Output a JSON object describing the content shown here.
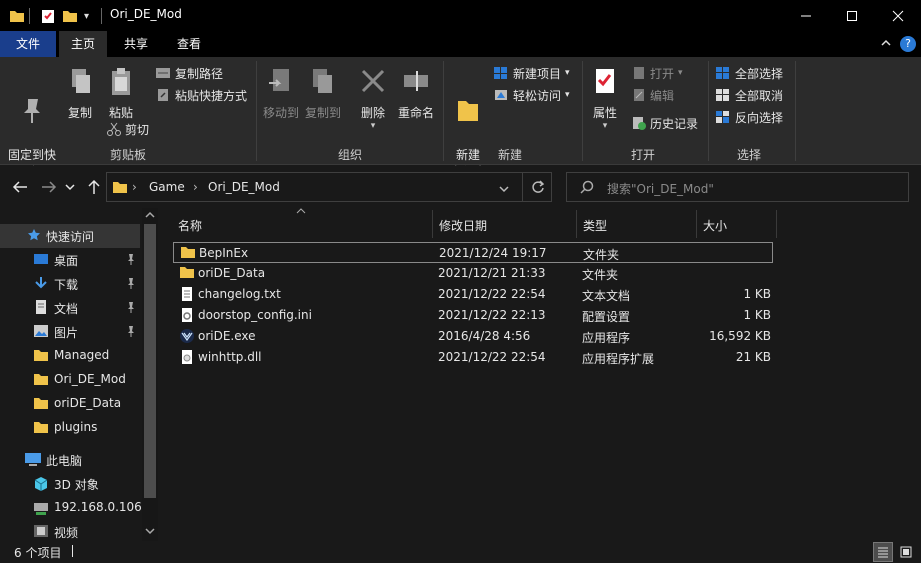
{
  "titlebar": {
    "title": "Ori_DE_Mod",
    "minimize": "—",
    "maximize": "☐",
    "close": "✕"
  },
  "tabs": {
    "file": "文件",
    "home": "主页",
    "share": "共享",
    "view": "查看"
  },
  "ribbon": {
    "clipboard": {
      "pin_quick": "固定到快\n速访问",
      "copy": "复制",
      "paste": "粘贴",
      "copy_path": "复制路径",
      "paste_shortcut": "粘贴快捷方式",
      "cut": "剪切",
      "label": "剪贴板"
    },
    "organize": {
      "move_to": "移动到",
      "copy_to": "复制到",
      "delete": "删除",
      "rename": "重命名",
      "label": "组织"
    },
    "new": {
      "new_folder": "新建\n文件夹",
      "new_item": "新建项目",
      "easy_access": "轻松访问",
      "label": "新建"
    },
    "open": {
      "properties": "属性",
      "open": "打开",
      "edit": "编辑",
      "history": "历史记录",
      "label": "打开"
    },
    "select": {
      "select_all": "全部选择",
      "select_none": "全部取消",
      "invert": "反向选择",
      "label": "选择"
    }
  },
  "address": {
    "crumbs": [
      "Game",
      "Ori_DE_Mod"
    ],
    "search_placeholder": "搜索\"Ori_DE_Mod\""
  },
  "navpane": {
    "items": [
      {
        "label": "快速访问",
        "icon": "star-icon",
        "pinned": false
      },
      {
        "label": "桌面",
        "icon": "desktop-icon",
        "pinned": true
      },
      {
        "label": "下载",
        "icon": "download-icon",
        "pinned": true
      },
      {
        "label": "文档",
        "icon": "document-icon",
        "pinned": true
      },
      {
        "label": "图片",
        "icon": "picture-icon",
        "pinned": true
      },
      {
        "label": "Managed",
        "icon": "folder-icon",
        "pinned": false
      },
      {
        "label": "Ori_DE_Mod",
        "icon": "folder-icon",
        "pinned": false
      },
      {
        "label": "oriDE_Data",
        "icon": "folder-icon",
        "pinned": false
      },
      {
        "label": "plugins",
        "icon": "folder-icon",
        "pinned": false
      },
      {
        "label": "此电脑",
        "icon": "computer-icon",
        "pinned": false
      },
      {
        "label": "3D 对象",
        "icon": "3d-objects-icon",
        "pinned": false
      },
      {
        "label": "192.168.0.106",
        "icon": "network-drive-icon",
        "pinned": false
      },
      {
        "label": "视频",
        "icon": "video-icon",
        "pinned": false
      }
    ]
  },
  "filelist": {
    "columns": {
      "name": "名称",
      "modified": "修改日期",
      "type": "类型",
      "size": "大小"
    },
    "rows": [
      {
        "name": "BepInEx",
        "modified": "2021/12/24 19:17",
        "type": "文件夹",
        "size": "",
        "icon": "folder-icon"
      },
      {
        "name": "oriDE_Data",
        "modified": "2021/12/21 21:33",
        "type": "文件夹",
        "size": "",
        "icon": "folder-icon"
      },
      {
        "name": "changelog.txt",
        "modified": "2021/12/22 22:54",
        "type": "文本文档",
        "size": "1 KB",
        "icon": "text-file-icon"
      },
      {
        "name": "doorstop_config.ini",
        "modified": "2021/12/22 22:13",
        "type": "配置设置",
        "size": "1 KB",
        "icon": "config-file-icon"
      },
      {
        "name": "oriDE.exe",
        "modified": "2016/4/28 4:56",
        "type": "应用程序",
        "size": "16,592 KB",
        "icon": "exe-icon"
      },
      {
        "name": "winhttp.dll",
        "modified": "2021/12/22 22:54",
        "type": "应用程序扩展",
        "size": "21 KB",
        "icon": "dll-file-icon"
      }
    ]
  },
  "status": {
    "count": "6 个项目"
  },
  "colors": {
    "folder": "#f0c34a",
    "file_tab": "#1a3e8c",
    "accent_blue": "#2a7ad6"
  }
}
